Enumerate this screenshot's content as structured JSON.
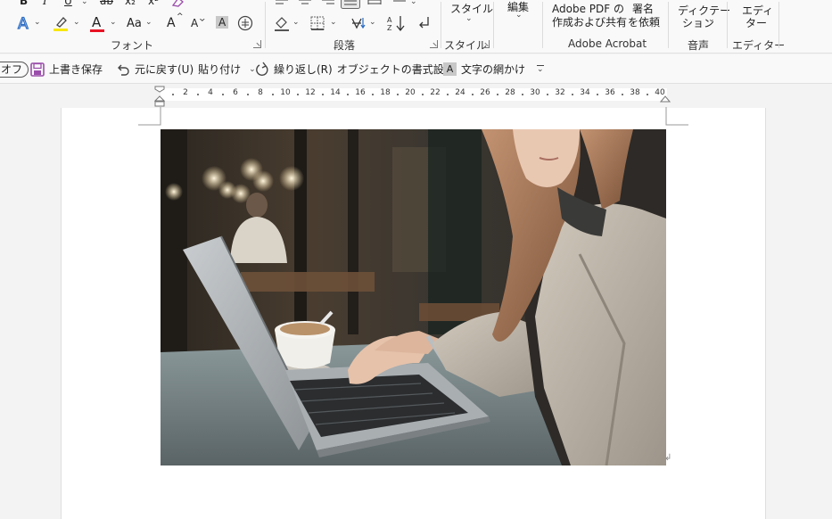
{
  "ribbon": {
    "font_group": {
      "label": "フォント",
      "bold": "B",
      "italic": "I",
      "underline": "U",
      "subscript": "x₂",
      "superscript": "x²",
      "font_color_letter": "A",
      "change_case": "Aa",
      "grow_font": "A",
      "shrink_font": "A",
      "char_shading": "A",
      "enclose_char": "字"
    },
    "paragraph_group": {
      "label": "段落"
    },
    "style_group": {
      "label": "スタイル",
      "button": "スタイル"
    },
    "edit_group": {
      "button": "編集"
    },
    "adobe_group": {
      "label": "Adobe Acrobat",
      "create_share_line1": "Adobe PDF の",
      "create_share_line2": "作成および共有",
      "request_sign_line1": "署名",
      "request_sign_line2": "を依頼"
    },
    "voice_group": {
      "label": "音声",
      "dictate_line1": "ディクテー",
      "dictate_line2": "ション"
    },
    "editor_group": {
      "label": "エディター",
      "editor_line1": "エディ",
      "editor_line2": "ター"
    }
  },
  "qat": {
    "autosave": "オフ",
    "save": "上書き保存",
    "undo": "元に戻す(U)",
    "paste": "貼り付け",
    "redo": "繰り返し(R)",
    "format_object": "オブジェクトの書式設定",
    "char_shading": "文字の網かけ"
  },
  "ruler": {
    "numbers": [
      "2",
      "4",
      "6",
      "8",
      "10",
      "12",
      "14",
      "16",
      "18",
      "20",
      "22",
      "24",
      "26",
      "28",
      "30",
      "32",
      "34",
      "36",
      "38",
      "40"
    ]
  },
  "colors": {
    "highlight_yellow": "#f7e70f",
    "font_red": "#e81123",
    "text_effect_blue": "#2b6cc4",
    "save_purple": "#9b4dab"
  }
}
